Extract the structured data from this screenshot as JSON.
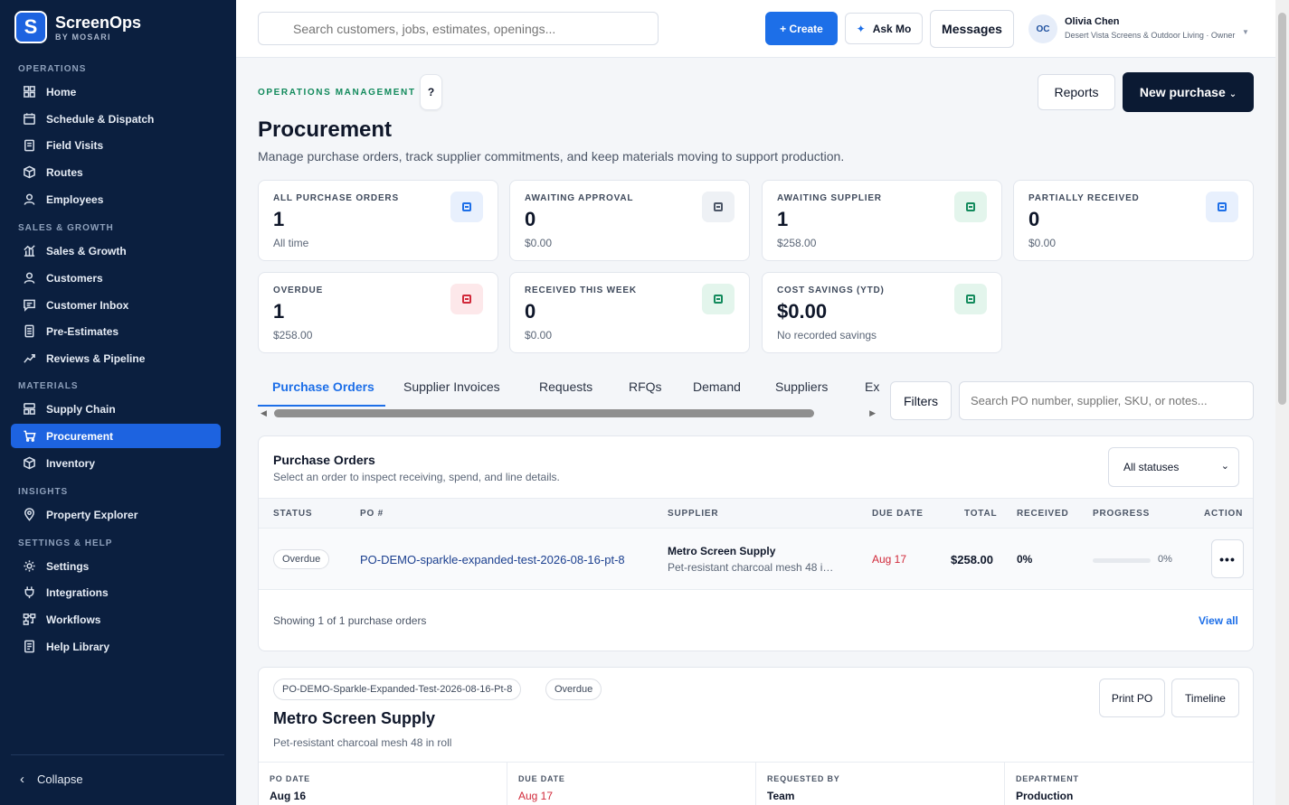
{
  "brand": {
    "logo_letter": "S",
    "name": "ScreenOps",
    "sub": "BY MOSARI"
  },
  "sidebar": {
    "sections": {
      "operations": "OPERATIONS",
      "sales": "SALES & GROWTH",
      "materials": "MATERIALS",
      "insights": "INSIGHTS",
      "settings": "SETTINGS & HELP"
    },
    "items": [
      {
        "label": "Home",
        "icon": "home-icon"
      },
      {
        "label": "Schedule & Dispatch",
        "icon": "calendar-icon"
      },
      {
        "label": "Field Visits",
        "icon": "clipboard-icon"
      },
      {
        "label": "Routes",
        "icon": "route-icon"
      },
      {
        "label": "Employees",
        "icon": "user-icon"
      },
      {
        "label": "Sales & Growth",
        "icon": "chart-icon"
      },
      {
        "label": "Customers",
        "icon": "user-icon"
      },
      {
        "label": "Customer Inbox",
        "icon": "inbox-icon"
      },
      {
        "label": "Pre-Estimates",
        "icon": "document-icon"
      },
      {
        "label": "Reviews & Pipeline",
        "icon": "trend-icon"
      },
      {
        "label": "Supply Chain",
        "icon": "boxes-icon"
      },
      {
        "label": "Procurement",
        "icon": "cart-icon"
      },
      {
        "label": "Inventory",
        "icon": "package-icon"
      },
      {
        "label": "Property Explorer",
        "icon": "map-pin-icon"
      },
      {
        "label": "Settings",
        "icon": "gear-icon"
      },
      {
        "label": "Integrations",
        "icon": "plug-icon"
      },
      {
        "label": "Workflows",
        "icon": "workflow-icon"
      },
      {
        "label": "Help Library",
        "icon": "book-icon"
      }
    ],
    "active": "Procurement",
    "collapse": "Collapse"
  },
  "topbar": {
    "search_placeholder": "Search customers, jobs, estimates, openings...",
    "create": "+ Create",
    "ask_mo": "Ask Mo",
    "messages": "Messages",
    "user": {
      "initials": "OC",
      "name": "Olivia Chen",
      "org": "Desert Vista Screens & Outdoor Living · Owner"
    }
  },
  "header": {
    "eyebrow": "OPERATIONS MANAGEMENT",
    "help": "?",
    "title": "Procurement",
    "subtitle": "Manage purchase orders, track supplier commitments, and keep materials moving to support production.",
    "reports": "Reports",
    "new_purchase": "New purchase"
  },
  "stats": [
    {
      "label": "ALL PURCHASE ORDERS",
      "value": "1",
      "sub": "All time",
      "tone": "blue"
    },
    {
      "label": "AWAITING APPROVAL",
      "value": "0",
      "sub": "$0.00",
      "tone": "gray"
    },
    {
      "label": "AWAITING SUPPLIER",
      "value": "1",
      "sub": "$258.00",
      "tone": "green"
    },
    {
      "label": "PARTIALLY RECEIVED",
      "value": "0",
      "sub": "$0.00",
      "tone": "blue"
    },
    {
      "label": "OVERDUE",
      "value": "1",
      "sub": "$258.00",
      "tone": "red"
    },
    {
      "label": "RECEIVED THIS WEEK",
      "value": "0",
      "sub": "$0.00",
      "tone": "green"
    },
    {
      "label": "COST SAVINGS (YTD)",
      "value": "$0.00",
      "sub": "No recorded savings",
      "tone": "green"
    }
  ],
  "tones": {
    "blue": {
      "bg": "#e8f0fd",
      "fg": "#1d6fe8"
    },
    "gray": {
      "bg": "#eef1f5",
      "fg": "#4b5566"
    },
    "green": {
      "bg": "#e3f5ec",
      "fg": "#128a5c"
    },
    "red": {
      "bg": "#fde8ea",
      "fg": "#d1293a"
    }
  },
  "tabs": [
    "Purchase Orders",
    "Supplier Invoices",
    "Requests",
    "RFQs",
    "Demand",
    "Suppliers",
    "Ex"
  ],
  "filters": "Filters",
  "po_search_placeholder": "Search PO number, supplier, SKU, or notes...",
  "table": {
    "title": "Purchase Orders",
    "subtitle": "Select an order to inspect receiving, spend, and line details.",
    "status_filter": "All statuses",
    "columns": [
      "STATUS",
      "PO #",
      "SUPPLIER",
      "DUE DATE",
      "TOTAL",
      "RECEIVED",
      "PROGRESS",
      "ACTION"
    ],
    "rows": [
      {
        "status": "Overdue",
        "po": "PO-DEMO-sparkle-expanded-test-2026-08-16-pt-8",
        "supplier": "Metro Screen Supply",
        "supplier_desc": "Pet-resistant charcoal mesh 48 in roll",
        "due": "Aug 17",
        "total": "$258.00",
        "received": "0%",
        "progress": 0,
        "progress_label": "0%",
        "action": "•••"
      }
    ],
    "showing": "Showing 1 of 1 purchase orders",
    "view_all": "View all"
  },
  "detail": {
    "po_chip": "PO-DEMO-Sparkle-Expanded-Test-2026-08-16-Pt-8",
    "status": "Overdue",
    "supplier": "Metro Screen Supply",
    "desc": "Pet-resistant charcoal mesh 48 in roll",
    "print": "Print PO",
    "timeline": "Timeline",
    "fields": [
      {
        "label": "PO DATE",
        "value": "Aug 16"
      },
      {
        "label": "DUE DATE",
        "value": "Aug 17"
      },
      {
        "label": "REQUESTED BY",
        "value": "Team"
      },
      {
        "label": "DEPARTMENT",
        "value": "Production"
      }
    ]
  }
}
